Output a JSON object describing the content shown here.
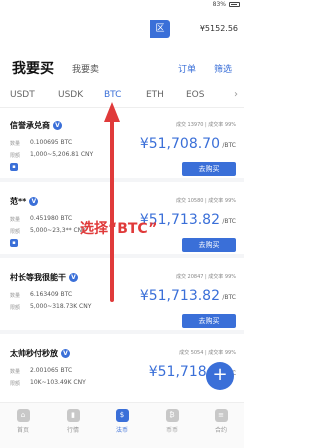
{
  "status_bar": {
    "battery": "83%"
  },
  "topbar": {
    "chip_label": "区",
    "balance": "¥5152.56"
  },
  "header": {
    "title": "我要买",
    "subtitle": "我要卖",
    "orders_label": "订单",
    "filter_label": "筛选"
  },
  "tabs": [
    {
      "label": "USDT"
    },
    {
      "label": "USDK"
    },
    {
      "label": "BTC",
      "active": true
    },
    {
      "label": "ETH"
    },
    {
      "label": "EOS"
    }
  ],
  "labels": {
    "quantity": "数量",
    "limit": "限额",
    "buy": "去购买",
    "unit": "/BTC"
  },
  "listings": [
    {
      "name": "信誉承兑商",
      "stats": "成交 13970 | 成交率 99%",
      "qty": "0.100695 BTC",
      "limit": "1,000~5,206.81 CNY",
      "price": "¥51,708.70"
    },
    {
      "name": "范**",
      "stats": "成交 10580 | 成交率 99%",
      "qty": "0.451980 BTC",
      "limit": "5,000~23,3** CNY",
      "price": "¥51,713.82"
    },
    {
      "name": "村长等我很能干",
      "stats": "成交 20847 | 成交率 99%",
      "qty": "6.163409 BTC",
      "limit": "5,000~318.73K CNY",
      "price": "¥51,713.82"
    },
    {
      "name": "太帅秒付秒放",
      "stats": "成交 5054 | 成交率 99%",
      "qty": "2.001065 BTC",
      "limit": "10K~103.49K CNY",
      "price": "¥51,718.9"
    }
  ],
  "annotation": {
    "text": "选择“BTC”"
  },
  "bottom_nav": [
    {
      "label": "首页"
    },
    {
      "label": "行情"
    },
    {
      "label": "法币",
      "active": true
    },
    {
      "label": "币币"
    },
    {
      "label": "合约"
    }
  ]
}
